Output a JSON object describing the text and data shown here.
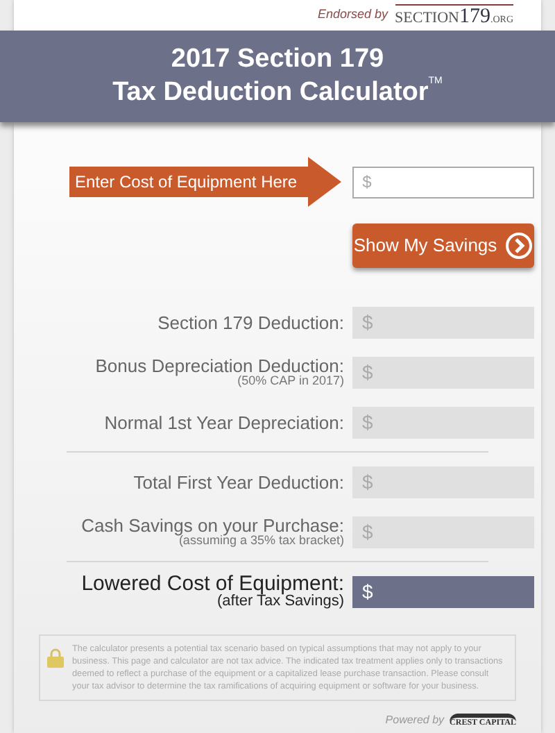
{
  "endorsement": {
    "label": "Endorsed by",
    "logo_parts": [
      "SECTION",
      "179",
      ".ORG"
    ]
  },
  "header": {
    "title": "2017 Section 179",
    "subtitle": "Tax Deduction Calculator",
    "mark": "TM"
  },
  "cost_input": {
    "callout": "Enter Cost of Equipment Here",
    "placeholder": "$"
  },
  "submit_button": {
    "label": "Show My Savings"
  },
  "result_groups": [
    {
      "rows": [
        {
          "kind": "normal",
          "label": "Section 179 Deduction:",
          "value": "$"
        },
        {
          "kind": "normal",
          "label": "Bonus Depreciation Deduction:",
          "note": "(50% CAP in 2017)",
          "value": "$"
        },
        {
          "kind": "normal",
          "label": "Normal 1st Year Depreciation:",
          "value": "$"
        }
      ]
    },
    {
      "rows": [
        {
          "kind": "normal",
          "label": "Total First Year Deduction:",
          "value": "$"
        },
        {
          "kind": "normal",
          "label": "Cash Savings on your Purchase:",
          "note": "(assuming a 35% tax bracket)",
          "value": "$"
        }
      ]
    },
    {
      "rows": [
        {
          "kind": "highlight",
          "label": "Lowered Cost of Equipment:",
          "note": "(after Tax Savings)",
          "value": "$"
        }
      ]
    }
  ],
  "disclaimer": "The calculator presents a potential tax scenario based on typical assumptions that may not apply to your business. This page and calculator are not tax advice. The indicated tax treatment applies only to transactions deemed to reflect a purchase of the equipment or a capitalized lease purchase transaction. Please consult your tax advisor to determine the tax ramifications of acquiring equipment or software for your business.",
  "footer": {
    "label": "Powered by",
    "logo": "CREST CAPITAL"
  }
}
